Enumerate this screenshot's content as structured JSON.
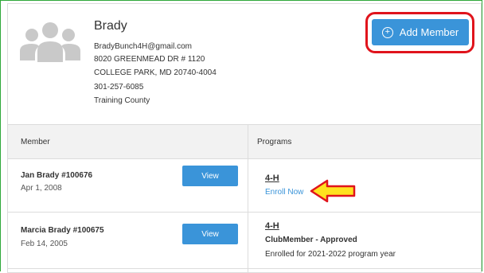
{
  "family": {
    "name": "Brady",
    "email": "BradyBunch4H@gmail.com",
    "address1": "8020 GREENMEAD DR # 1120",
    "address2": "COLLEGE PARK, MD 20740-4004",
    "phone": "301-257-6085",
    "county": "Training County"
  },
  "actions": {
    "add_member_label": "Add Member",
    "add_member_icon": "plus-circle-icon"
  },
  "table": {
    "headers": {
      "member": "Member",
      "programs": "Programs"
    },
    "rows": [
      {
        "member_name": "Jan Brady #100676",
        "dob": "Apr 1, 2008",
        "view_label": "View",
        "program": "4-H",
        "enroll_label": "Enroll Now"
      },
      {
        "member_name": "Marcia Brady #100675",
        "dob": "Feb 14, 2005",
        "view_label": "View",
        "program": "4-H",
        "status": "ClubMember - Approved",
        "year_text": "Enrolled for 2021-2022 program year"
      }
    ]
  },
  "colors": {
    "primary_button": "#3a94d9",
    "highlight_box": "#e0141c",
    "arrow_fill": "#ffe21f",
    "arrow_stroke": "#e0141c",
    "frame": "#2fa83a"
  }
}
